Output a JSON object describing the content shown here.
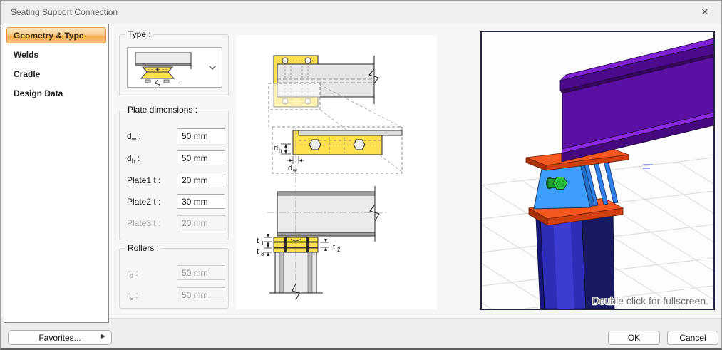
{
  "window": {
    "title": "Seating Support Connection"
  },
  "icons": {
    "close": "✕",
    "favorites_arrow": "▶"
  },
  "sidebar": {
    "items": [
      {
        "label": "Geometry & Type",
        "selected": true
      },
      {
        "label": "Welds",
        "selected": false
      },
      {
        "label": "Cradle",
        "selected": false
      },
      {
        "label": "Design Data",
        "selected": false
      }
    ]
  },
  "favorites": {
    "label": "Favorites..."
  },
  "groups": {
    "type": {
      "title": "Type :"
    },
    "plate": {
      "title": "Plate dimensions :",
      "fields": [
        {
          "base": "d",
          "sub": "w",
          "suffix": " :",
          "value": "50 mm",
          "enabled": true
        },
        {
          "base": "d",
          "sub": "h",
          "suffix": " :",
          "value": "50 mm",
          "enabled": true
        },
        {
          "base": "Plate1 t",
          "sub": "",
          "suffix": " :",
          "value": "20 mm",
          "enabled": true
        },
        {
          "base": "Plate2 t",
          "sub": "",
          "suffix": " :",
          "value": "30 mm",
          "enabled": true
        },
        {
          "base": "Plate3 t",
          "sub": "",
          "suffix": " :",
          "value": "20 mm",
          "enabled": false
        }
      ]
    },
    "rollers": {
      "title": "Rollers :",
      "fields": [
        {
          "base": "r",
          "sub": "d",
          "suffix": " :",
          "value": "50 mm",
          "enabled": false
        },
        {
          "base": "r",
          "sub": "e",
          "suffix": " :",
          "value": "50 mm",
          "enabled": false
        }
      ]
    }
  },
  "diagram": {
    "dims": {
      "dh": {
        "base": "d",
        "sub": "h"
      },
      "dw": {
        "base": "d",
        "sub": "w"
      },
      "t1": {
        "base": "t",
        "sub": "1"
      },
      "t2": {
        "base": "t",
        "sub": "2"
      },
      "t3": {
        "base": "t",
        "sub": "3"
      }
    }
  },
  "preview": {
    "hint": "Double click for fullscreen."
  },
  "footer": {
    "ok": "OK",
    "cancel": "Cancel"
  },
  "colors": {
    "selected_item_accent": "#F3AC4E",
    "plate_yellow": "#FFE14F",
    "beam_purple": "#5A10A2",
    "column_blue": "#2D2DB8",
    "plate_orange": "#F4581F",
    "wedge_blue": "#3D9EFC",
    "bolt_green": "#2ECC44",
    "preview_border": "#23263E"
  }
}
